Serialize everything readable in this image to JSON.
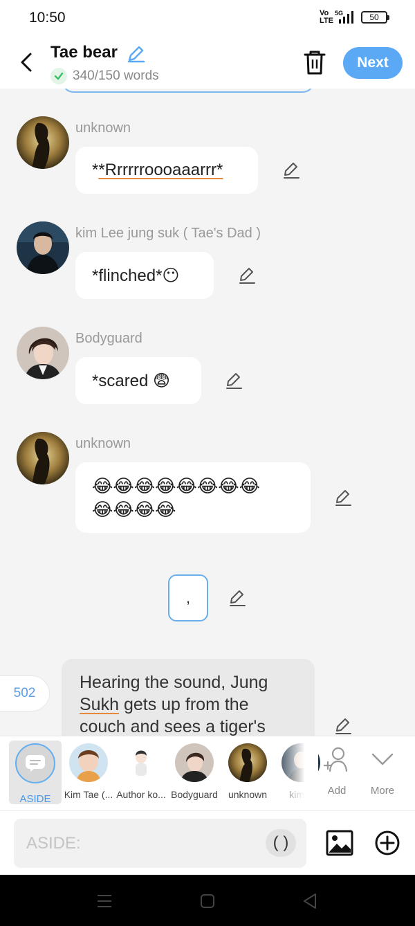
{
  "status_bar": {
    "time": "10:50",
    "network": "5G",
    "volte": "Vo LTE",
    "battery": "50"
  },
  "header": {
    "title": "Tae bear",
    "word_count": "340/150 words",
    "next_label": "Next"
  },
  "messages": [
    {
      "sender": "unknown",
      "text": "*Rrrrrroooaaarrr*"
    },
    {
      "sender": "kim Lee jung suk ( Tae's Dad )",
      "text": "*flinched*😶"
    },
    {
      "sender": "Bodyguard",
      "text": "*scared 😨"
    },
    {
      "sender": "unknown",
      "line1": "😂😂😂😂😂😂😂😂",
      "line2": "😂😂😂😂"
    }
  ],
  "comma_box": {
    "text": ","
  },
  "narration": {
    "number": "502",
    "text_before": "Hearing the sound, Jung",
    "text_underlined": "Sukh",
    "text_after": "gets up from the couch and sees a tiger's"
  },
  "characters": {
    "aside_label": "ASIDE",
    "items": [
      {
        "name": "Kim Tae (..."
      },
      {
        "name": "Author ko..."
      },
      {
        "name": "Bodyguard"
      },
      {
        "name": "unknown"
      },
      {
        "name": "kim L"
      }
    ],
    "add_label": "Add",
    "more_label": "More"
  },
  "input": {
    "placeholder": "ASIDE:",
    "paren_label": "( )"
  },
  "colors": {
    "accent": "#5ba9f5",
    "underline": "#e8883a",
    "background": "#f4f4f4"
  }
}
